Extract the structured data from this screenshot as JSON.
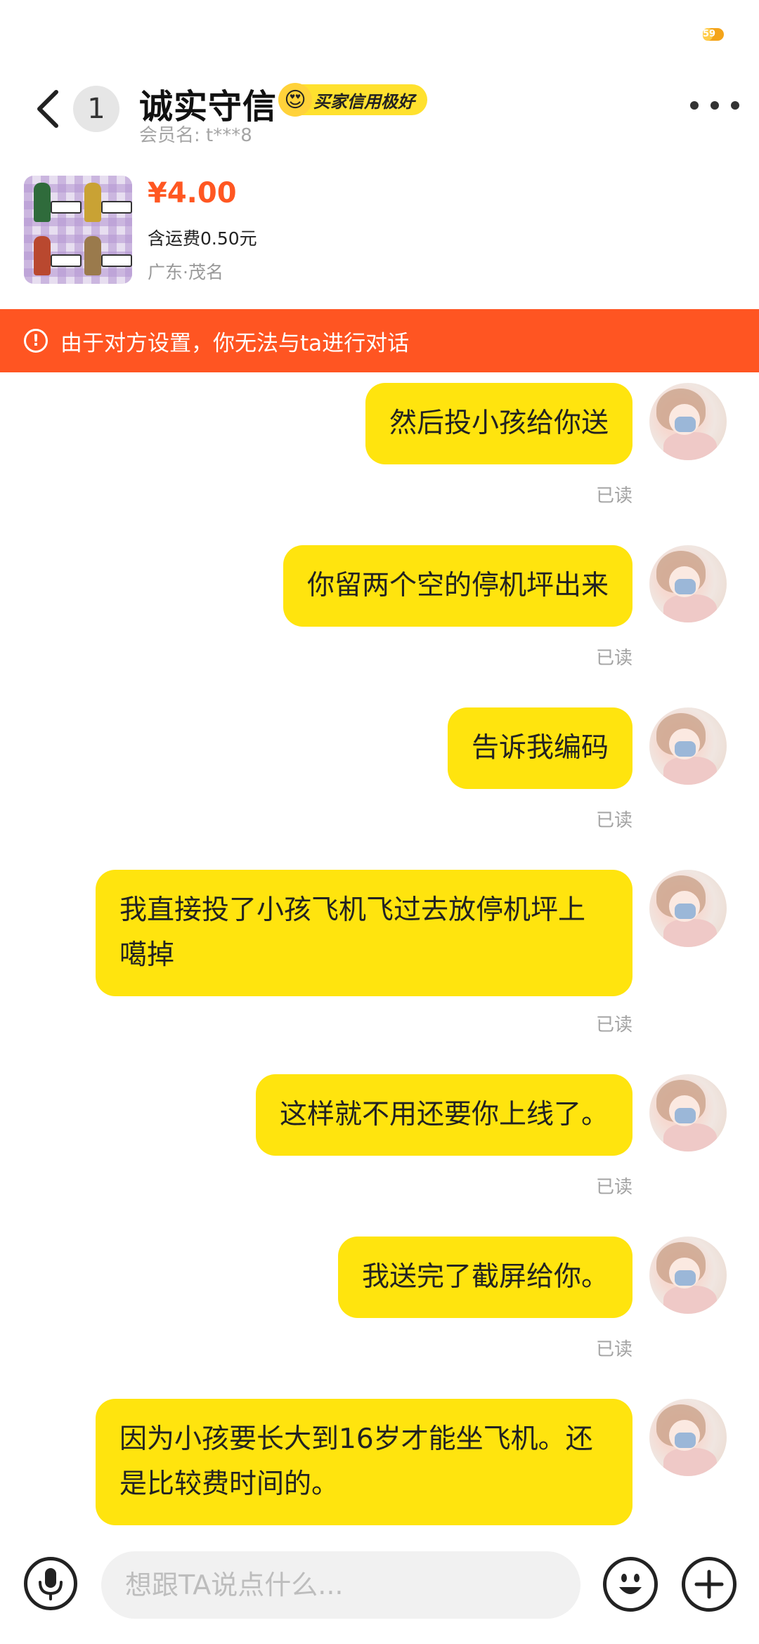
{
  "status_bar": {
    "battery_text": "59"
  },
  "header": {
    "back_icon": "chevron-left-icon",
    "unread_count": "1",
    "seller_name": "诚实守信",
    "credit_badge": "买家信用极好",
    "member_name": "会员名: t***8",
    "more_icon": "more-dots-icon"
  },
  "product": {
    "price": "¥4.00",
    "shipping": "含运费0.50元",
    "location": "广东·茂名"
  },
  "warning": {
    "icon": "exclamation-circle-icon",
    "text": "由于对方设置，你无法与ta进行对话"
  },
  "messages": [
    {
      "text": "然后投小孩给你送",
      "status": "已读"
    },
    {
      "text": "你留两个空的停机坪出来",
      "status": "已读"
    },
    {
      "text": "告诉我编码",
      "status": "已读"
    },
    {
      "text": "我直接投了小孩飞机飞过去放停机坪上噶掉",
      "status": "已读"
    },
    {
      "text": "这样就不用还要你上线了。",
      "status": "已读"
    },
    {
      "text": "我送完了截屏给你。",
      "status": "已读"
    },
    {
      "text": "因为小孩要长大到16岁才能坐飞机。还是比较费时间的。",
      "status": "已读"
    }
  ],
  "input_bar": {
    "placeholder": "想跟TA说点什么...",
    "voice_icon": "microphone-icon",
    "emoji_icon": "smiley-icon",
    "plus_icon": "plus-icon"
  },
  "colors": {
    "bubble": "#ffe40e",
    "warning_bg": "#ff5522",
    "price": "#ff5722"
  }
}
